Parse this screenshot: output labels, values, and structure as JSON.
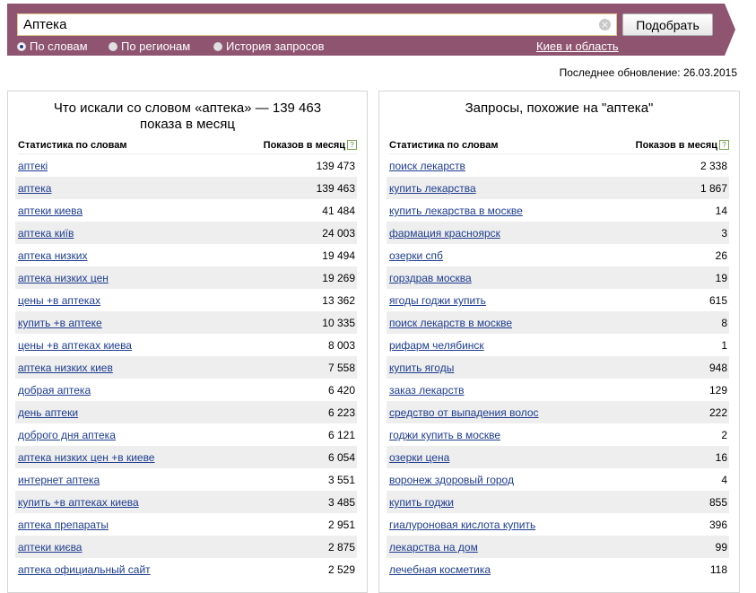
{
  "search": {
    "query": "Аптека",
    "submit_label": "Подобрать",
    "clear_symbol": "×"
  },
  "search_modes": [
    {
      "label": "По словам",
      "selected": true
    },
    {
      "label": "По регионам",
      "selected": false
    },
    {
      "label": "История запросов",
      "selected": false
    }
  ],
  "region": "Киев и область",
  "last_update": "Последнее обновление: 26.03.2015",
  "left_panel": {
    "title_line1": "Что искали со словом «аптека» — 139 463",
    "title_line2": "показа в месяц",
    "col_words": "Статистика по словам",
    "col_shows": "Показов в месяц",
    "help_symbol": "?",
    "rows": [
      {
        "phrase": "аптекі",
        "count": "139 473"
      },
      {
        "phrase": "аптека",
        "count": "139 463"
      },
      {
        "phrase": "аптеки киева",
        "count": "41 484"
      },
      {
        "phrase": "аптека київ",
        "count": "24 003"
      },
      {
        "phrase": "аптека низких",
        "count": "19 494"
      },
      {
        "phrase": "аптека низких цен",
        "count": "19 269"
      },
      {
        "phrase": "цены +в аптеках",
        "count": "13 362"
      },
      {
        "phrase": "купить +в аптеке",
        "count": "10 335"
      },
      {
        "phrase": "цены +в аптеках киева",
        "count": "8 003"
      },
      {
        "phrase": "аптека низких киев",
        "count": "7 558"
      },
      {
        "phrase": "добрая аптека",
        "count": "6 420"
      },
      {
        "phrase": "день аптеки",
        "count": "6 223"
      },
      {
        "phrase": "доброго дня аптека",
        "count": "6 121"
      },
      {
        "phrase": "аптека низких цен +в киеве",
        "count": "6 054"
      },
      {
        "phrase": "интернет аптека",
        "count": "3 551"
      },
      {
        "phrase": "купить +в аптеках киева",
        "count": "3 485"
      },
      {
        "phrase": "аптека препараты",
        "count": "2 951"
      },
      {
        "phrase": "аптеки києва",
        "count": "2 875"
      },
      {
        "phrase": "аптека официальный сайт",
        "count": "2 529"
      }
    ]
  },
  "right_panel": {
    "title": "Запросы, похожие на \"аптека\"",
    "col_words": "Статистика по словам",
    "col_shows": "Показов в месяц",
    "help_symbol": "?",
    "rows": [
      {
        "phrase": "поиск лекарств",
        "count": "2 338"
      },
      {
        "phrase": "купить лекарства",
        "count": "1 867"
      },
      {
        "phrase": "купить лекарства в москве",
        "count": "14"
      },
      {
        "phrase": "фармация красноярск",
        "count": "3"
      },
      {
        "phrase": "озерки спб",
        "count": "26"
      },
      {
        "phrase": "горздрав москва",
        "count": "19"
      },
      {
        "phrase": "ягоды годжи купить",
        "count": "615"
      },
      {
        "phrase": "поиск лекарств в москве",
        "count": "8"
      },
      {
        "phrase": "рифарм челябинск",
        "count": "1"
      },
      {
        "phrase": "купить ягоды",
        "count": "948"
      },
      {
        "phrase": "заказ лекарств",
        "count": "129"
      },
      {
        "phrase": "средство от выпадения волос",
        "count": "222"
      },
      {
        "phrase": "годжи купить в москве",
        "count": "2"
      },
      {
        "phrase": "озерки цена",
        "count": "16"
      },
      {
        "phrase": "воронеж здоровый город",
        "count": "4"
      },
      {
        "phrase": "купить годжи",
        "count": "855"
      },
      {
        "phrase": "гиалуроновая кислота купить",
        "count": "396"
      },
      {
        "phrase": "лекарства на дом",
        "count": "99"
      },
      {
        "phrase": "лечебная косметика",
        "count": "118"
      }
    ]
  }
}
